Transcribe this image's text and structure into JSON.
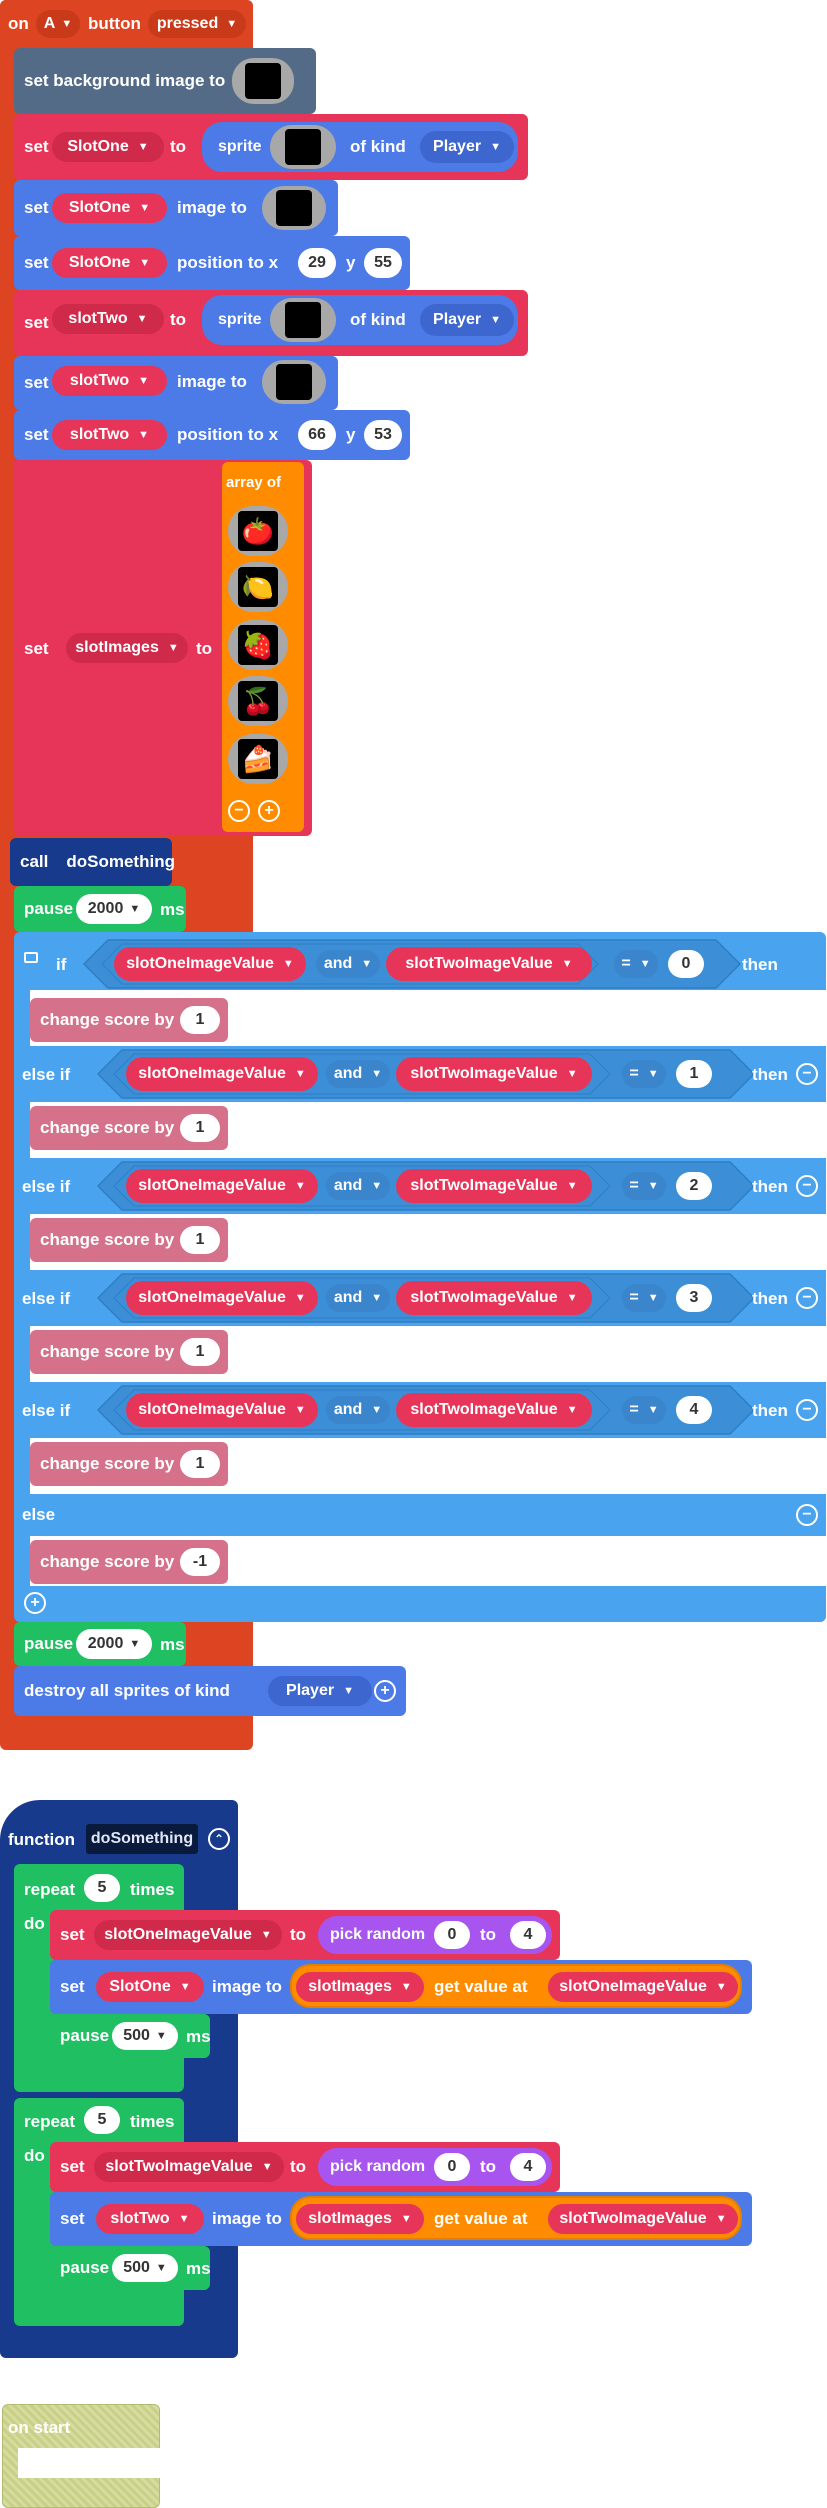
{
  "event": {
    "on": "on",
    "key": "A",
    "button": "button",
    "state": "pressed"
  },
  "kw": {
    "set": "set",
    "to": "to",
    "sprite": "sprite",
    "of_kind": "of kind",
    "image_to": "image to",
    "position_to_x": "position to x",
    "y": "y",
    "array_of": "array of",
    "call": "call",
    "pause": "pause",
    "ms": "ms",
    "if": "if",
    "then": "then",
    "else_if": "else if",
    "else": "else",
    "and": "and",
    "eq": "=",
    "change_score_by": "change score by",
    "destroy_all": "destroy all sprites of kind",
    "function": "function",
    "repeat": "repeat",
    "times": "times",
    "do": "do",
    "pick_random": "pick random",
    "get_value_at": "get value at",
    "on_start": "on start"
  },
  "main": {
    "set_background": "set background image to",
    "slot_one": "SlotOne",
    "slot_two": "slotTwo",
    "kind": "Player",
    "slot_one_x": "29",
    "slot_one_y": "55",
    "slot_two_x": "66",
    "slot_two_y": "53",
    "slot_images": "slotImages",
    "func_call": "doSomething",
    "pause1": "2000",
    "pause2": "2000",
    "var_one": "slotOneImageValue",
    "var_two": "slotTwoImageValue",
    "conds": [
      "0",
      "1",
      "2",
      "3",
      "4"
    ],
    "score_changes": [
      "1",
      "1",
      "1",
      "1",
      "1",
      "-1"
    ],
    "destroy_kind": "Player"
  },
  "func": {
    "name": "doSomething",
    "repeat1": "5",
    "repeat2": "5",
    "rand_min": "0",
    "rand_max": "4",
    "rand_min2": "0",
    "rand_max2": "4",
    "pause_a": "500",
    "pause_b": "500"
  },
  "fruits": [
    "tomato-icon",
    "lemon-icon",
    "strawberry-icon",
    "cherry-icon",
    "cake-icon"
  ]
}
